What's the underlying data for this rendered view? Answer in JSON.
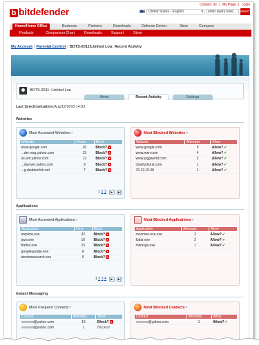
{
  "brand": {
    "name": "bitdefender"
  },
  "top_links": [
    "Contact Us",
    "My Page",
    "Login"
  ],
  "top_links_sep": "|",
  "language": {
    "selected": "United States - English"
  },
  "search": {
    "placeholder": "enter query here...",
    "button_label": "search"
  },
  "nav_main": [
    "Home/Home Office",
    "Business",
    "Partners",
    "Downloads",
    "Defense Center",
    "Store",
    "Company"
  ],
  "nav_sub": [
    "Products",
    "Comparison Chart",
    "Downloads",
    "Support",
    "Store"
  ],
  "breadcrumb": {
    "items": [
      "My Account",
      "Parental Control"
    ],
    "current": "BDTS-2011\\Limited Lou: Recent Activity",
    "sep": "/"
  },
  "user": {
    "name": "BDTS-2011: Limited Lou"
  },
  "tabs": [
    {
      "label": "Alerts",
      "active": false
    },
    {
      "label": "Recent Activity",
      "active": true
    },
    {
      "label": "Settings",
      "active": false
    }
  ],
  "sync": {
    "label": "Last Synchronization:",
    "value": "Aug/12/2010 14:03"
  },
  "sections": {
    "websites": "Websites",
    "applications": "Applications",
    "im": "Instant Messaging"
  },
  "accessed_websites": {
    "title": "Most Accessed Websites",
    "help": "?",
    "columns": [
      "Website",
      "Views",
      "Block"
    ],
    "rows": [
      {
        "site": "www.google.com",
        "views": "20",
        "action": "Block?"
      },
      {
        "site": "...der.msg.yahoo.com",
        "views": "15",
        "action": "Block?"
      },
      {
        "site": "us.ard.yahoo.com",
        "views": "12",
        "action": "Block?"
      },
      {
        "site": "...dserver.yahoo.com",
        "views": "9",
        "action": "Block?"
      },
      {
        "site": "...g.doubleclick.net",
        "views": "7",
        "action": "Block?"
      }
    ],
    "pages": [
      "1",
      "2",
      "3"
    ]
  },
  "blocked_websites": {
    "title": "Most Blocked Websites",
    "help": "?",
    "columns": [
      "Website",
      "Attempts",
      "Allow"
    ],
    "rows": [
      {
        "site": "www.google.com",
        "attempts": "9",
        "action": "Allow?"
      },
      {
        "site": "www.msn.com",
        "attempts": "4",
        "action": "Allow?"
      },
      {
        "site": "www.juggworld.com",
        "attempts": "2",
        "action": "Allow?"
      },
      {
        "site": "clearlydrunk.com",
        "attempts": "1",
        "action": "Allow?"
      },
      {
        "site": "76.13.15.38",
        "attempts": "1",
        "action": "Allow?"
      }
    ]
  },
  "accessed_apps": {
    "title": "Most Accessed Applications",
    "help": "?",
    "columns": [
      "Application",
      "Time",
      "Block"
    ],
    "rows": [
      {
        "app": "iexplore.exe",
        "time": "32",
        "action": "Block?"
      },
      {
        "app": "java.exe",
        "time": "16",
        "action": "Block?"
      },
      {
        "app": "firefox.exe",
        "time": "15",
        "action": "Block?"
      },
      {
        "app": "googleupdate.exe",
        "time": "8",
        "action": "Block?"
      },
      {
        "app": "windowssearch.exe",
        "time": "6",
        "action": "Block?"
      }
    ],
    "pages": [
      "1",
      "2",
      "3",
      "4"
    ]
  },
  "blocked_apps": {
    "title": "Most Blocked Applications",
    "help": "?",
    "columns": [
      "Application",
      "Attempts",
      "Allow"
    ],
    "rows": [
      {
        "app": "moomoo.exe.exe",
        "attempts": "2",
        "action": "Allow?"
      },
      {
        "app": "fubar.exe",
        "attempts": "2",
        "action": "Allow?"
      },
      {
        "app": "msmsgs.exe",
        "attempts": "1",
        "action": "Allow?"
      }
    ]
  },
  "frequent_contacts": {
    "title": "Most Frequent Contacts",
    "help": "?",
    "columns": [
      "Contact",
      "Attempts",
      "Block"
    ],
    "rows": [
      {
        "contact": "@yahoo.com",
        "attempts": "16",
        "action": "Block?"
      },
      {
        "contact": "@yahoo.com",
        "attempts": "1",
        "action": "Blocked"
      }
    ]
  },
  "blocked_contacts": {
    "title": "Most Blocked Contacts",
    "help": "?",
    "columns": [
      "Contact",
      "Attempts",
      "Allow"
    ],
    "rows": [
      {
        "contact": "@yahoo.com",
        "attempts": "1",
        "action": "Allow?"
      }
    ]
  },
  "pager_icons": {
    "next": "next-page-icon",
    "last": "last-page-icon"
  },
  "colors": {
    "brand_red": "#cc0000",
    "header_blue": "#8fbcd1",
    "header_red": "#d46a6a",
    "allow_green": "#2a9a2a"
  }
}
